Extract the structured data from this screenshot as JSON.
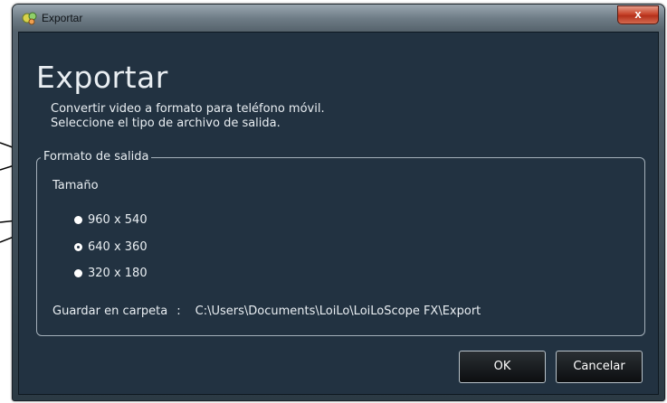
{
  "window": {
    "title": "Exportar",
    "close_label": "x"
  },
  "dialog": {
    "heading": "Exportar",
    "description_line1": "Convertir video a formato para teléfono móvil.",
    "description_line2": "Seleccione el tipo de archivo de salida."
  },
  "output_format": {
    "legend": "Formato de salida",
    "size_label": "Tamaño",
    "options": [
      {
        "label": "960 x 540",
        "checked": false
      },
      {
        "label": "640 x 360",
        "checked": true
      },
      {
        "label": "320 x 180",
        "checked": false
      }
    ],
    "folder_label": "Guardar en carpeta",
    "folder_separator": ":",
    "folder_path": "C:\\Users\\Documents\\LoiLo\\LoiLoScope FX\\Export"
  },
  "buttons": {
    "ok": "OK",
    "cancel": "Cancelar"
  },
  "colors": {
    "client_bg": "#223241",
    "text": "#e9eef2",
    "close": "#c8462c"
  }
}
